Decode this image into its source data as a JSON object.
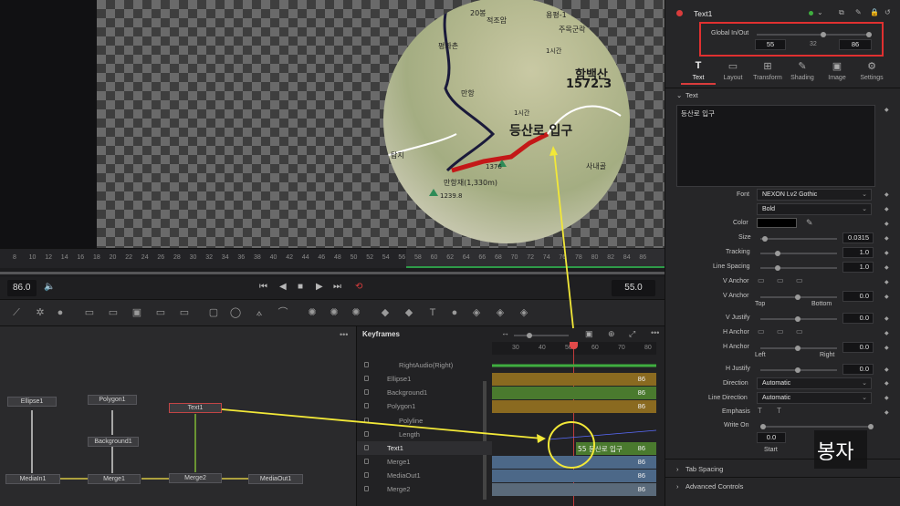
{
  "viewer": {
    "map_texts": [
      "20봉",
      "적조암",
      "용평-1",
      "주목군락",
      "1시간",
      "함백산",
      "1572.3",
      "평화촌",
      "만항",
      "1시간",
      "등산로 입구",
      "사내골",
      "탐지",
      "1376",
      "만항재(1,330m)",
      "1239.8"
    ]
  },
  "ruler": {
    "ticks": [
      "8",
      "10",
      "12",
      "14",
      "16",
      "18",
      "20",
      "22",
      "24",
      "26",
      "28",
      "30",
      "32",
      "34",
      "36",
      "38",
      "40",
      "42",
      "44",
      "46",
      "48",
      "50",
      "52",
      "54",
      "56",
      "58",
      "60",
      "62",
      "64",
      "66",
      "68",
      "70",
      "72",
      "74",
      "76",
      "78",
      "80",
      "82",
      "84",
      "86"
    ]
  },
  "transport": {
    "duration": "86.0",
    "current_time": "55.0"
  },
  "nodes": {
    "ellipse": "Ellipse1",
    "polygon": "Polygon1",
    "text": "Text1",
    "background": "Background1",
    "mediain": "MediaIn1",
    "merge1": "Merge1",
    "merge2": "Merge2",
    "mediaout": "MediaOut1"
  },
  "keyframes": {
    "title": "Keyframes",
    "ruler_ticks": [
      "30",
      "40",
      "50",
      "60",
      "70",
      "80"
    ],
    "rows": [
      {
        "name": "RightAudio(Right)",
        "value": ""
      },
      {
        "name": "Ellipse1",
        "value": "86"
      },
      {
        "name": "Background1",
        "value": "86"
      },
      {
        "name": "Polygon1",
        "value": "86"
      },
      {
        "name": "Polyline",
        "value": ""
      },
      {
        "name": "Length",
        "value": ""
      },
      {
        "name": "Text1",
        "value": "86"
      },
      {
        "name": "Merge1",
        "value": "86"
      },
      {
        "name": "MediaOut1",
        "value": "86"
      },
      {
        "name": "Merge2",
        "value": "86"
      }
    ],
    "text1_clip_label": "55 등산로 입구"
  },
  "inspector": {
    "node_name": "Text1",
    "global_inout": {
      "label": "Global In/Out",
      "in": "55",
      "mid": "32",
      "out": "86"
    },
    "tabs": [
      {
        "label": "Text",
        "icon": "text-tool-icon"
      },
      {
        "label": "Layout",
        "icon": "layout-icon"
      },
      {
        "label": "Transform",
        "icon": "transform-icon"
      },
      {
        "label": "Shading",
        "icon": "shading-icon"
      },
      {
        "label": "Image",
        "icon": "image-icon"
      },
      {
        "label": "Settings",
        "icon": "settings-icon"
      }
    ],
    "section_text": "Text",
    "styled_text": "등산로 입구",
    "font_label": "Font",
    "font_value": "NEXON Lv2 Gothic",
    "style_value": "Bold",
    "color_label": "Color",
    "size_label": "Size",
    "size_value": "0.0315",
    "tracking_label": "Tracking",
    "tracking_value": "1.0",
    "line_spacing_label": "Line Spacing",
    "line_spacing_value": "1.0",
    "v_anchor_label": "V Anchor",
    "v_anchor2_label": "V Anchor",
    "v_anchor_value": "0.0",
    "v_top": "Top",
    "v_bottom": "Bottom",
    "v_justify_label": "V Justify",
    "v_justify_value": "0.0",
    "h_anchor_label": "H Anchor",
    "h_anchor2_label": "H Anchor",
    "h_anchor_value": "0.0",
    "h_left": "Left",
    "h_right": "Right",
    "h_justify_label": "H Justify",
    "h_justify_value": "0.0",
    "direction_label": "Direction",
    "direction_value": "Automatic",
    "line_direction_label": "Line Direction",
    "line_direction_value": "Automatic",
    "emphasis_label": "Emphasis",
    "write_on_label": "Write On",
    "write_on_value": "0.0",
    "write_on_start": "Start",
    "tab_spacing": "Tab Spacing",
    "advanced_controls": "Advanced Controls"
  },
  "watermark": "봉자",
  "colors": {
    "accent_red": "#d93c3c",
    "annotation_yellow": "#f2e838",
    "green_clip": "#4a7a2e",
    "orange_clip": "#8a6a20",
    "blue_clip": "#4c6888"
  }
}
